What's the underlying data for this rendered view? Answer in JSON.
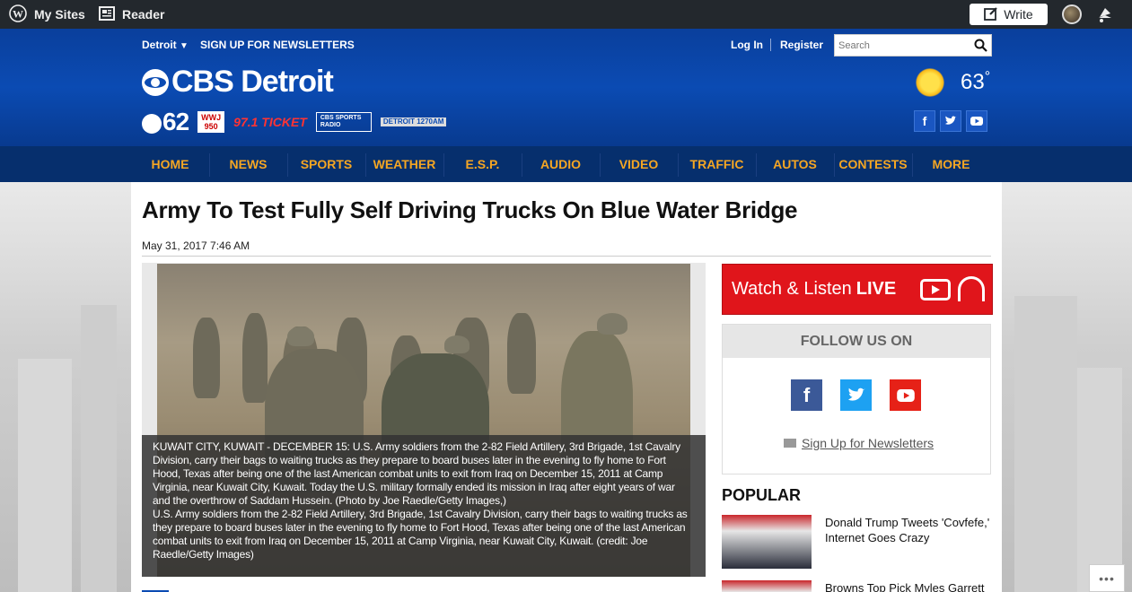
{
  "wpbar": {
    "my_sites": "My Sites",
    "reader": "Reader",
    "write": "Write"
  },
  "header": {
    "location": "Detroit",
    "newsletter_signup": "SIGN UP FOR NEWSLETTERS",
    "login": "Log In",
    "register": "Register",
    "search_placeholder": "Search",
    "logo_text": "CBS Detroit",
    "stations": {
      "s62": "62",
      "wwj": "WWJ 950",
      "ticket": "97.1 TICKET",
      "cbs_sports": "CBS SPORTS RADIO",
      "detroit_am": "DETROIT 1270AM"
    },
    "temperature": "63",
    "degree": "°"
  },
  "nav": {
    "items": [
      "HOME",
      "NEWS",
      "SPORTS",
      "WEATHER",
      "E.S.P.",
      "AUDIO",
      "VIDEO",
      "TRAFFIC",
      "AUTOS",
      "CONTESTS",
      "MORE"
    ]
  },
  "article": {
    "headline": "Army To Test Fully Self Driving Trucks On Blue Water Bridge",
    "date": "May 31, 2017 7:46 AM",
    "caption_1": "KUWAIT CITY, KUWAIT - DECEMBER 15: U.S. Army soldiers from the 2-82 Field Artillery, 3rd Brigade, 1st Cavalry Division, carry their bags to waiting trucks as they prepare to board buses later in the evening to fly home to Fort Hood, Texas after being one of the last American combat units to exit from Iraq on December 15, 2011 at Camp Virginia, near Kuwait City, Kuwait. Today the U.S. military formally ended its mission in Iraq after eight years of war and the overthrow of Saddam Hussein. (Photo by Joe Raedle/Getty Images,)",
    "caption_2": "U.S. Army soldiers from the 2-82 Field Artillery, 3rd Brigade, 1st Cavalry Division, carry their bags to waiting trucks as they prepare to board buses later in the evening to fly home to Fort Hood, Texas after being one of the last American combat units to exit from Iraq on December 15, 2011 at Camp Virginia, near Kuwait City, Kuwait. (credit: Joe Raedle/Getty Images)"
  },
  "sidebar": {
    "live_prefix": "Watch & Listen",
    "live_bold": "LIVE",
    "follow_title": "FOLLOW US ON",
    "newsletter_link": "Sign Up for Newsletters",
    "popular_title": "POPULAR",
    "popular": [
      {
        "title": "Donald Trump Tweets 'Covfefe,' Internet Goes Crazy"
      },
      {
        "title": "Browns Top Pick Myles Garrett"
      }
    ]
  },
  "colors": {
    "header_blue": "#0b4bb3",
    "nav_bg": "#062f6d",
    "nav_text": "#f5a623",
    "live_red": "#e0151b",
    "facebook": "#3b5998",
    "twitter": "#1da1f2",
    "youtube": "#e62117"
  },
  "icons": {
    "wp": "wordpress-icon",
    "reader": "reader-icon",
    "write": "pencil-icon",
    "notif": "bell-icon",
    "search": "search-icon",
    "weather": "sun-icon"
  }
}
